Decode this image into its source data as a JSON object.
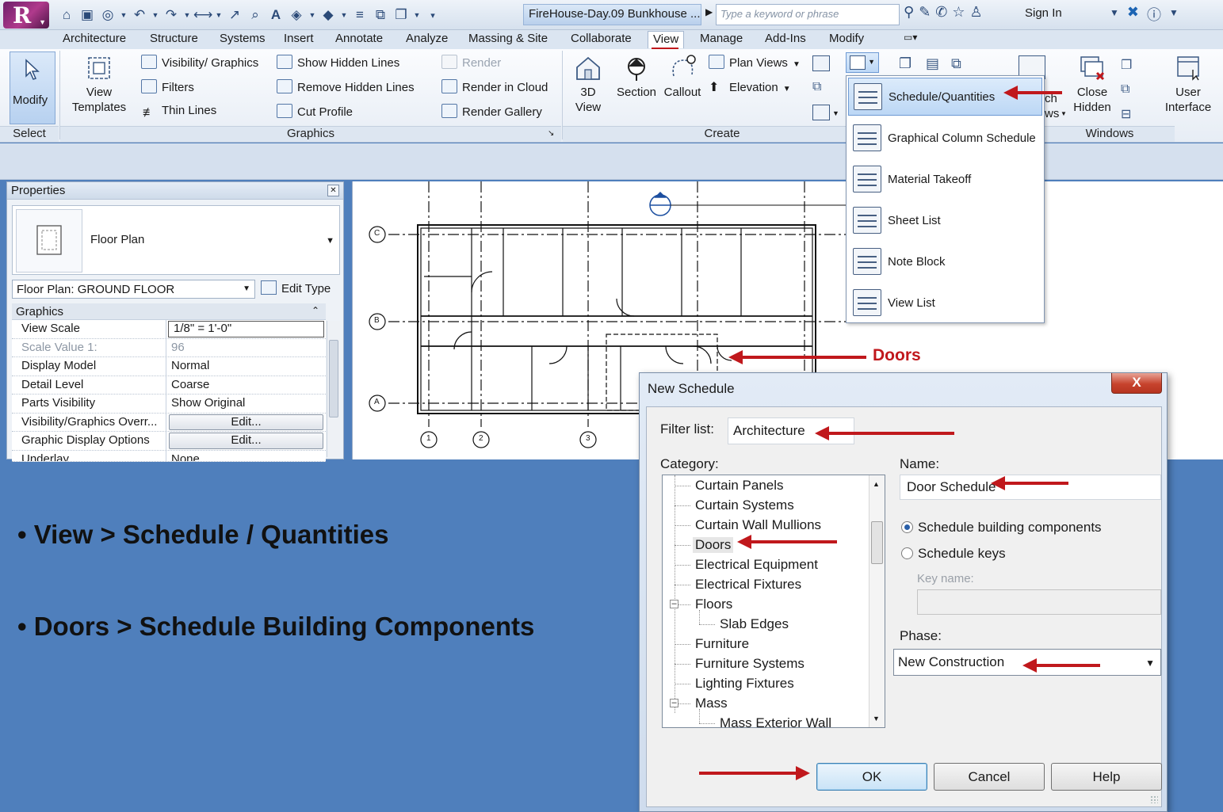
{
  "titlebar": {
    "app_letter": "R",
    "document_title": "FireHouse-Day.09 Bunkhouse ...",
    "search_placeholder": "Type a keyword or phrase",
    "signin_label": "Sign In"
  },
  "menu_tabs": [
    "Architecture",
    "Structure",
    "Systems",
    "Insert",
    "Annotate",
    "Analyze",
    "Massing & Site",
    "Collaborate",
    "View",
    "Manage",
    "Add-Ins",
    "Modify"
  ],
  "active_tab": "View",
  "ribbon": {
    "select_panel": {
      "modify_label": "Modify",
      "panel_label": "Select"
    },
    "graphics_panel": {
      "view_templates_label_1": "View",
      "view_templates_label_2": "Templates",
      "visibility_graphics": "Visibility/ Graphics",
      "filters": "Filters",
      "thin_lines": "Thin  Lines",
      "show_hidden_lines": "Show  Hidden Lines",
      "remove_hidden_lines": "Remove  Hidden Lines",
      "cut_profile": "Cut  Profile",
      "render": "Render",
      "render_in_cloud": "Render  in Cloud",
      "render_gallery": "Render  Gallery",
      "panel_label": "Graphics"
    },
    "create_panel": {
      "view_3d_label_1": "3D",
      "view_3d_label_2": "View",
      "section": "Section",
      "callout": "Callout",
      "plan_views": "Plan  Views",
      "elevation": "Elevation",
      "panel_label": "Create"
    },
    "windows_panel": {
      "switch_partial_1": "ch",
      "switch_partial_2": "ws",
      "close_hidden_1": "Close",
      "close_hidden_2": "Hidden",
      "user_interface_1": "User",
      "user_interface_2": "Interface",
      "panel_label": "Windows"
    }
  },
  "schedule_menu": {
    "items": [
      "Schedule/Quantities",
      "Graphical Column Schedule",
      "Material Takeoff",
      "Sheet List",
      "Note Block",
      "View List"
    ],
    "highlighted_index": 0
  },
  "properties": {
    "header": "Properties",
    "type_name": "Floor Plan",
    "instance_selector": "Floor Plan: GROUND FLOOR",
    "edit_type_label": "Edit Type",
    "section": "Graphics",
    "rows": [
      {
        "key": "View Scale",
        "value": "1/8\" = 1'-0\"",
        "style": "boxed"
      },
      {
        "key": "Scale Value    1:",
        "value": "96",
        "style": "dim"
      },
      {
        "key": "Display Model",
        "value": "Normal",
        "style": ""
      },
      {
        "key": "Detail Level",
        "value": "Coarse",
        "style": ""
      },
      {
        "key": "Parts Visibility",
        "value": "Show Original",
        "style": ""
      },
      {
        "key": "Visibility/Graphics Overr...",
        "value": "Edit...",
        "style": "btn"
      },
      {
        "key": "Graphic Display Options",
        "value": "Edit...",
        "style": "btn"
      },
      {
        "key": "Underlay",
        "value": "None",
        "style": ""
      }
    ]
  },
  "plan": {
    "grid_rows": [
      "C",
      "B",
      "A"
    ],
    "grid_cols": [
      "1",
      "2",
      "3"
    ]
  },
  "annotations": {
    "doors_label": "Doors"
  },
  "bullets": [
    "• View > Schedule / Quantities",
    "• Doors > Schedule Building Components"
  ],
  "dialog": {
    "title": "New Schedule",
    "close_glyph": "X",
    "filter_label": "Filter list:",
    "filter_value": "Architecture",
    "category_label": "Category:",
    "categories": [
      {
        "label": "Curtain Panels",
        "level": 1
      },
      {
        "label": "Curtain Systems",
        "level": 1
      },
      {
        "label": "Curtain Wall Mullions",
        "level": 1
      },
      {
        "label": "Doors",
        "level": 1
      },
      {
        "label": "Electrical Equipment",
        "level": 1
      },
      {
        "label": "Electrical Fixtures",
        "level": 1
      },
      {
        "label": "Floors",
        "level": 1
      },
      {
        "label": "Slab Edges",
        "level": 2
      },
      {
        "label": "Furniture",
        "level": 1
      },
      {
        "label": "Furniture Systems",
        "level": 1
      },
      {
        "label": "Lighting Fixtures",
        "level": 1
      },
      {
        "label": "Mass",
        "level": 1
      },
      {
        "label": "Mass Exterior Wall",
        "level": 2
      }
    ],
    "selected_category": "Doors",
    "name_label": "Name:",
    "name_value": "Door Schedule",
    "radio_components": "Schedule building components",
    "radio_keys": "Schedule keys",
    "key_name_label": "Key name:",
    "phase_label": "Phase:",
    "phase_value": "New Construction",
    "ok_label": "OK",
    "cancel_label": "Cancel",
    "help_label": "Help"
  },
  "colors": {
    "background": "#4f7fbc",
    "annotation_red": "#c0181c",
    "ribbon": "#e7edf5"
  }
}
